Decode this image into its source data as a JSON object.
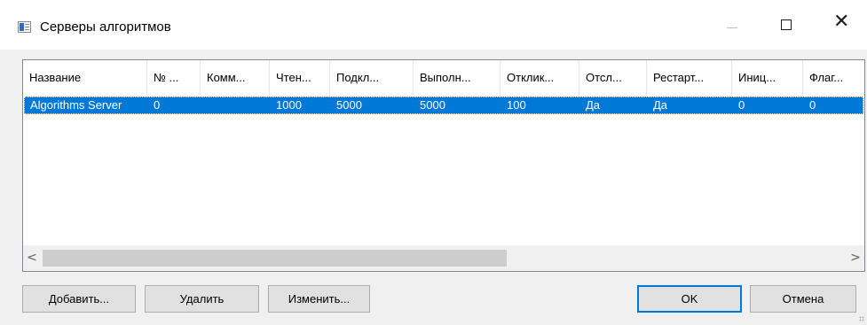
{
  "window": {
    "title": "Серверы алгоритмов",
    "controls": {
      "minimize": "—",
      "maximize": "☐",
      "close": "✕"
    }
  },
  "list": {
    "columns": [
      "Название",
      "№ ...",
      "Комм...",
      "Чтен...",
      "Подкл...",
      "Выполн...",
      "Отклик...",
      "Отсл...",
      "Рестарт...",
      "Иниц...",
      "Флаг..."
    ],
    "rows": [
      {
        "cells": [
          "Algorithms Server",
          "0",
          "",
          "1000",
          "5000",
          "5000",
          "100",
          "Да",
          "Да",
          "0",
          "0"
        ],
        "selected": true
      }
    ],
    "scrollbar": {
      "left_arrow": "<",
      "right_arrow": ">"
    }
  },
  "buttons": {
    "add": "Добавить...",
    "delete": "Удалить",
    "edit": "Изменить...",
    "ok": "OK",
    "cancel": "Отмена"
  },
  "colors": {
    "selection": "#0078d7",
    "default_button_border": "#0078d7"
  }
}
